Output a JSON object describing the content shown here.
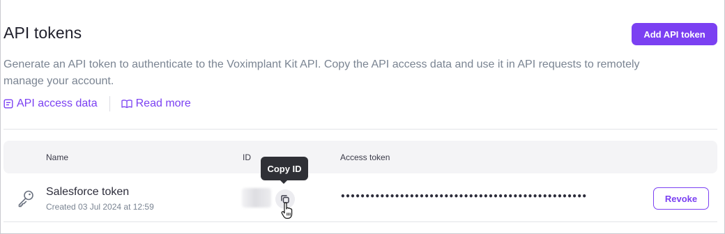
{
  "header": {
    "title": "API tokens",
    "add_button_label": "Add API token",
    "description": "Generate an API token to authenticate to the Voximplant Kit API. Copy the API access data and use it in API requests to remotely manage your account."
  },
  "links": {
    "access_data_label": "API access data",
    "read_more_label": "Read more"
  },
  "table": {
    "columns": {
      "name": "Name",
      "id": "ID",
      "access_token": "Access token"
    },
    "rows": [
      {
        "name": "Salesforce token",
        "created": "Created 03 Jul 2024 at 12:59",
        "access_token_masked": "••••••••••••••••••••••••••••••••••••••••••••••••••",
        "revoke_label": "Revoke"
      }
    ]
  },
  "tooltip": {
    "text": "Copy ID"
  },
  "colors": {
    "accent": "#7b40f2",
    "muted_text": "#7a8492",
    "header_bg": "#f4f4f6",
    "tooltip_bg": "#2f3036"
  },
  "icons": {
    "access_data": "document-list-icon",
    "read_more": "open-book-icon",
    "token": "key-icon",
    "copy": "copy-icon",
    "cursor": "hand-pointer-icon"
  }
}
